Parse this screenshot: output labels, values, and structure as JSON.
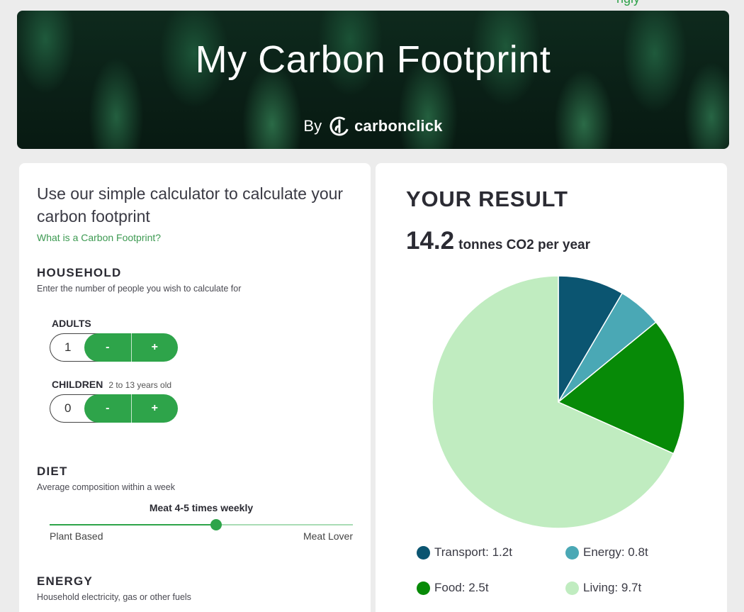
{
  "top_link": "ngly",
  "hero": {
    "title": "My Carbon Footprint",
    "by": "By",
    "brand": "carbonclick"
  },
  "calculator": {
    "intro": "Use our simple calculator to calculate your carbon footprint",
    "what_link": "What is a Carbon Footprint?",
    "household": {
      "title": "HOUSEHOLD",
      "subtitle": "Enter the number of people you wish to calculate for",
      "adults": {
        "label": "ADULTS",
        "value": "1",
        "minus": "-",
        "plus": "+"
      },
      "children": {
        "label": "CHILDREN",
        "hint": "2 to 13 years old",
        "value": "0",
        "minus": "-",
        "plus": "+"
      }
    },
    "diet": {
      "title": "DIET",
      "subtitle": "Average composition within a week",
      "value_label": "Meat 4-5 times weekly",
      "slider_fraction": 0.55,
      "min_label": "Plant Based",
      "max_label": "Meat Lover"
    },
    "energy": {
      "title": "ENERGY",
      "subtitle": "Household electricity, gas or other fuels"
    }
  },
  "result": {
    "title": "YOUR RESULT",
    "value": "14.2",
    "unit": "tonnes CO2 per year"
  },
  "chart_data": {
    "type": "pie",
    "series": [
      {
        "name": "Transport",
        "value": 1.2,
        "color": "#0b5571"
      },
      {
        "name": "Energy",
        "value": 0.8,
        "color": "#4aa8b5"
      },
      {
        "name": "Food",
        "value": 2.5,
        "color": "#078a07"
      },
      {
        "name": "Living",
        "value": 9.7,
        "color": "#c0ecc0"
      }
    ],
    "legend_labels": [
      "Transport: 1.2t",
      "Energy: 0.8t",
      "Food: 2.5t",
      "Living: 9.7t"
    ],
    "legend_placement": "bottom"
  }
}
